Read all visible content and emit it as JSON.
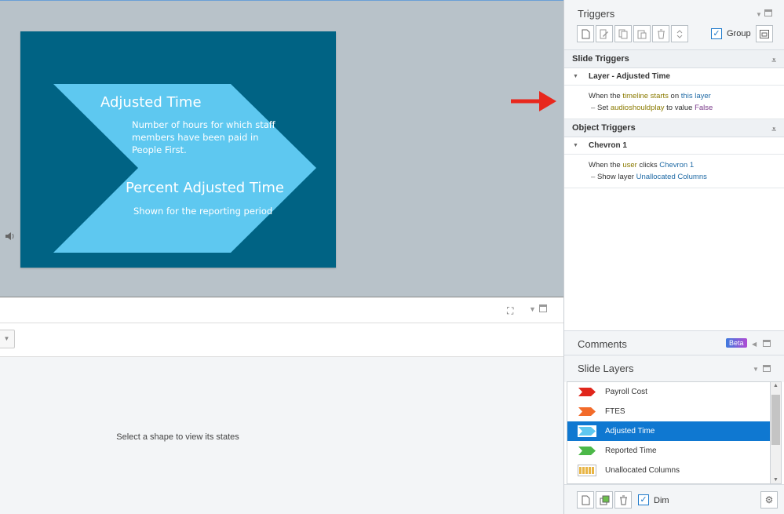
{
  "slide": {
    "title1": "Adjusted Time",
    "body1": "Number of hours for which staff members have been paid in People First.",
    "title2": "Percent Adjusted Time",
    "body2": "Shown for the reporting period",
    "colors": {
      "background": "#006384",
      "chevron": "#5ec8f0"
    }
  },
  "states": {
    "empty_message": "Select a shape to view its states"
  },
  "triggers": {
    "title": "Triggers",
    "group_label": "Group",
    "group_checked": true,
    "slide_triggers": {
      "title": "Slide Triggers",
      "groups": [
        {
          "name": "Layer - Adjusted Time",
          "line1": {
            "pre": "When the ",
            "event": "timeline starts",
            "mid": " on ",
            "target": "this layer"
          },
          "line2": {
            "pre": "Set ",
            "var": "audioshouldplay",
            "mid": " to value ",
            "val": "False"
          }
        }
      ]
    },
    "object_triggers": {
      "title": "Object Triggers",
      "groups": [
        {
          "name": "Chevron 1",
          "line1": {
            "pre": "When the ",
            "event": "user",
            "mid": " clicks ",
            "target": "Chevron 1"
          },
          "line2": {
            "pre": "Show layer ",
            "target": "Unallocated Columns"
          }
        }
      ]
    }
  },
  "comments": {
    "title": "Comments",
    "badge": "Beta"
  },
  "layers": {
    "title": "Slide Layers",
    "items": [
      {
        "label": "Payroll Cost",
        "color": "#e0261b"
      },
      {
        "label": "FTES",
        "color": "#f26b2a"
      },
      {
        "label": "Adjusted Time",
        "color": "#5ec8f0"
      },
      {
        "label": "Reported Time",
        "color": "#4cb848"
      },
      {
        "label": "Unallocated Columns",
        "color": "#e8b545"
      }
    ],
    "selected_index": 2,
    "dim_label": "Dim",
    "dim_checked": true
  },
  "accent": "#0f78d1"
}
